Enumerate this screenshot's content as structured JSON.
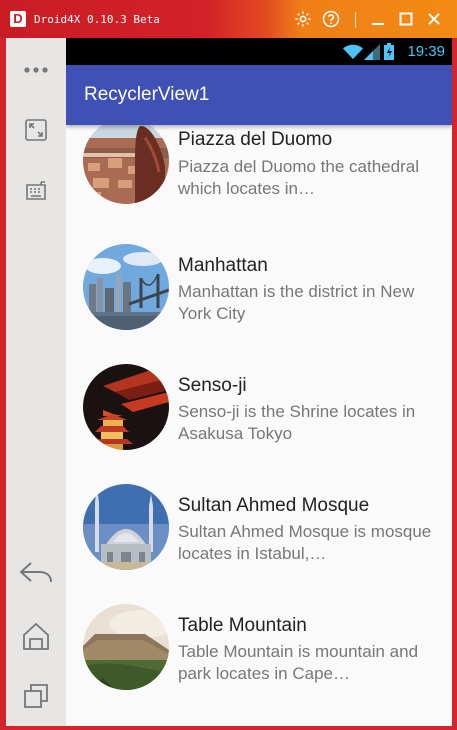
{
  "window": {
    "title": "Droid4X 0.10.3 Beta",
    "logo_text": "D",
    "settings_icon": "gear-icon",
    "help_icon": "question-icon",
    "minimize_icon": "minimize-icon",
    "maximize_icon": "maximize-icon",
    "close_icon": "close-icon"
  },
  "sidebar": {
    "items": [
      {
        "icon": "more-dots-icon"
      },
      {
        "icon": "fullscreen-icon"
      },
      {
        "icon": "keyboard-icon"
      },
      {
        "icon": "back-icon"
      },
      {
        "icon": "home-icon"
      },
      {
        "icon": "recent-apps-icon"
      }
    ]
  },
  "statusbar": {
    "time": "19:39",
    "icons": [
      "wifi-icon",
      "signal-icon",
      "battery-icon"
    ]
  },
  "actionbar": {
    "title": "RecyclerView1",
    "color": "#3f51b5"
  },
  "list": {
    "items": [
      {
        "title": "Piazza del Duomo",
        "desc": "Piazza del Duomo the cathedral which locates in…"
      },
      {
        "title": "Manhattan",
        "desc": "Manhattan is the district in New York City"
      },
      {
        "title": "Senso-ji",
        "desc": "Senso-ji is the Shrine locates in Asakusa Tokyo"
      },
      {
        "title": "Sultan Ahmed Mosque",
        "desc": "Sultan Ahmed Mosque is mosque locates in Istabul,…"
      },
      {
        "title": "Table Mountain",
        "desc": "Table Mountain is mountain and park locates in Cape…"
      }
    ]
  }
}
